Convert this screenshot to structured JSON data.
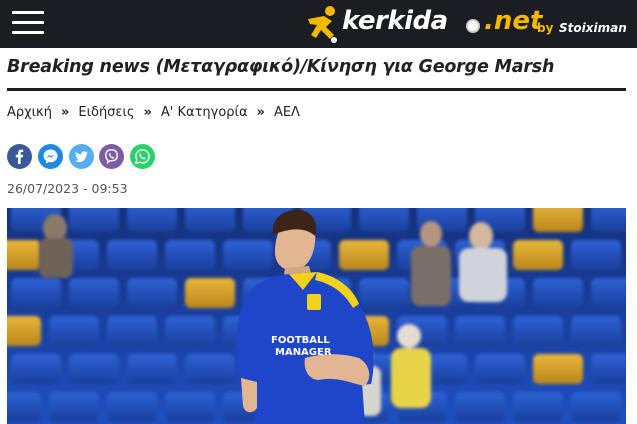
{
  "header": {
    "menu_icon": "hamburger-menu-icon",
    "brand": {
      "name": "kerkida",
      "tld": "net",
      "by": "by",
      "sponsor": "Stoiximan",
      "colors": {
        "background": "#1b1d22",
        "accent": "#f5b800"
      }
    }
  },
  "article": {
    "title": "Breaking news (Μεταγραφικό)/Κίνηση για George Marsh",
    "breadcrumb": [
      "Αρχική",
      "Ειδήσεις",
      "Α' Κατηγορία",
      "ΑΕΛ"
    ],
    "breadcrumb_separator": "»",
    "date": "26/07/2023 - 09:53",
    "share": [
      {
        "network": "facebook",
        "icon": "facebook-icon",
        "color": "#3b5998"
      },
      {
        "network": "messenger",
        "icon": "messenger-icon",
        "color": "#1e88e5"
      },
      {
        "network": "twitter",
        "icon": "twitter-icon",
        "color": "#55acee"
      },
      {
        "network": "viber",
        "icon": "viber-icon",
        "color": "#7d5ba6"
      },
      {
        "network": "whatsapp",
        "icon": "whatsapp-icon",
        "color": "#25d366"
      }
    ],
    "hero_image": {
      "description_icon": "player-photo",
      "shirt_sponsor": "FOOTBALL MANAGER"
    }
  }
}
